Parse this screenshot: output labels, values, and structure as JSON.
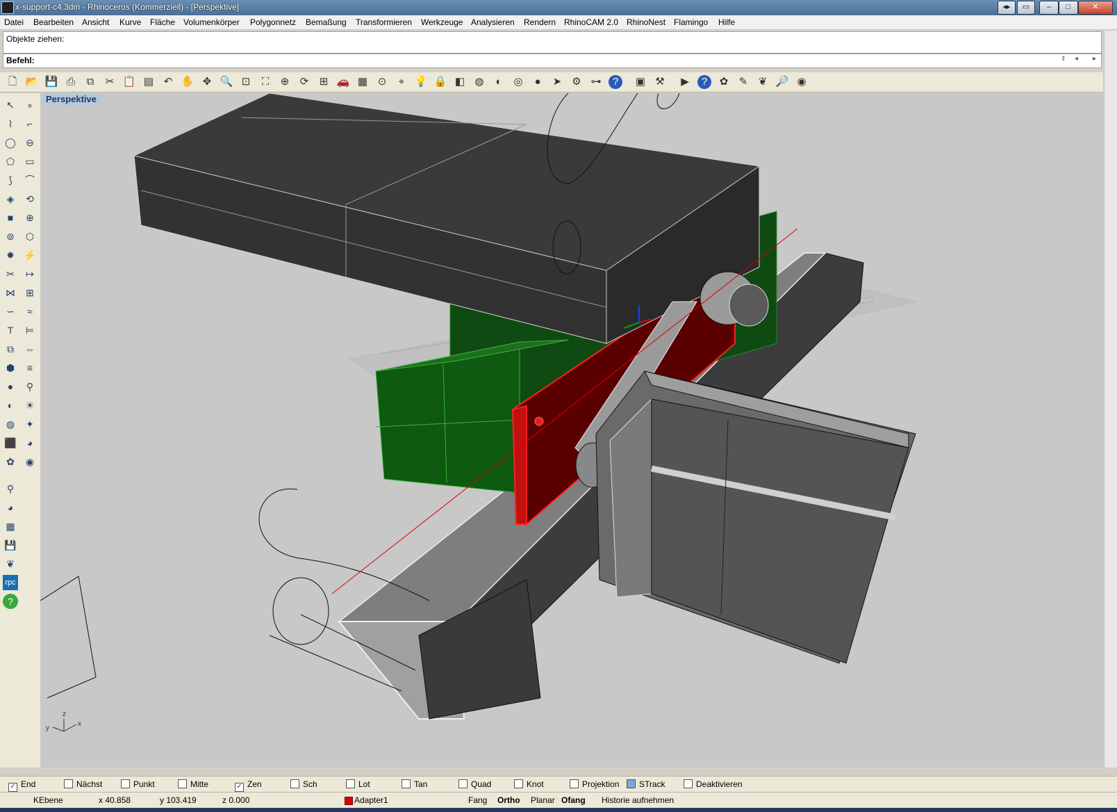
{
  "window": {
    "title": "x-support-c4.3dm - Rhinoceros (Kommerziell) - [Perspektive]",
    "minimize": "–",
    "maximize": "□",
    "close": "✕"
  },
  "menu": [
    "Datei",
    "Bearbeiten",
    "Ansicht",
    "Kurve",
    "Fläche",
    "Volumenkörper",
    "Polygonnetz",
    "Bemaßung",
    "Transformieren",
    "Werkzeuge",
    "Analysieren",
    "Rendern",
    "RhinoCAM 2.0",
    "RhinoNest",
    "Flamingo",
    "Hilfe"
  ],
  "command": {
    "history": "Objekte ziehen:",
    "label": "Befehl:",
    "value": ""
  },
  "toolbar_icons": [
    "new-file-icon",
    "open-icon",
    "save-icon",
    "print-icon",
    "copy-icon",
    "cut-icon",
    "paste-icon",
    "clipboard-icon",
    "undo-icon",
    "pan-icon",
    "move-icon",
    "zoom-icon",
    "zoom-window-icon",
    "zoom-extents-icon",
    "zoom-selected-icon",
    "rotate-view-icon",
    "viewport-layout-icon",
    "car-icon",
    "grid-icon",
    "snap-icon",
    "osnap-icon",
    "light-icon",
    "lock-icon",
    "layer-icon",
    "color-icon",
    "shade-icon",
    "render-icon",
    "sphere-icon",
    "pointer-icon",
    "gear-icon",
    "hierarchy-icon",
    "help-icon",
    "nest-icon",
    "tool-icon",
    "play-icon",
    "help-icon-2",
    "flamingo-icon",
    "paint-icon",
    "leaf-icon",
    "zoom-icon-2",
    "earth-icon"
  ],
  "viewport": {
    "label": "Perspektive"
  },
  "axes": {
    "z": "z",
    "y": "y",
    "x": "x"
  },
  "osnaps": [
    {
      "label": "End",
      "checked": true
    },
    {
      "label": "Nächst",
      "checked": false
    },
    {
      "label": "Punkt",
      "checked": false
    },
    {
      "label": "Mitte",
      "checked": false
    },
    {
      "label": "Zen",
      "checked": true
    },
    {
      "label": "Sch",
      "checked": false
    },
    {
      "label": "Lot",
      "checked": false
    },
    {
      "label": "Tan",
      "checked": false
    },
    {
      "label": "Quad",
      "checked": false
    },
    {
      "label": "Knot",
      "checked": false
    },
    {
      "label": "Projektion",
      "checked": false
    },
    {
      "label": "STrack",
      "checked": false
    },
    {
      "label": "Deaktivieren",
      "checked": false
    }
  ],
  "status": {
    "plane": "KEbene",
    "x": "x 40.858",
    "y": "y 103.419",
    "z": "z 0.000",
    "layer": "Adapter1",
    "layer_color": "#e00000",
    "fang": "Fang",
    "ortho": "Ortho",
    "planar": "Planar",
    "ofang": "Ofang",
    "history": "Historie aufnehmen"
  }
}
